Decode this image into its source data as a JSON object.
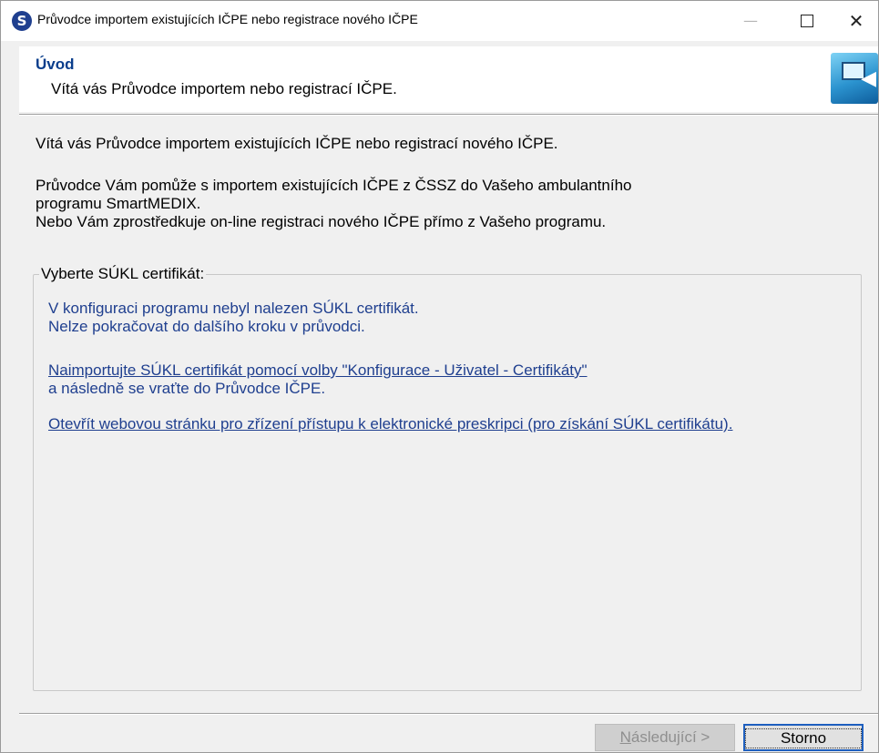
{
  "window": {
    "title": "Průvodce importem existujících IČPE nebo registrace nového IČPE",
    "app_icon_letter": "S",
    "controls": {
      "minimize": "—",
      "maximize": "",
      "close": "✕"
    }
  },
  "header": {
    "title": "Úvod",
    "subtitle": "Vítá vás Průvodce importem nebo registrací IČPE."
  },
  "body": {
    "welcome": "Vítá vás Průvodce importem existujících IČPE nebo registrací nového IČPE.",
    "description": [
      "Průvodce Vám pomůže s importem existujících IČPE z ČSSZ do Vašeho ambulantního",
      "programu SmartMEDIX.",
      "Nebo Vám zprostředkuje on-line registraci nového IČPE přímo z Vašeho programu."
    ]
  },
  "certificate_group": {
    "label": "Vyberte SÚKL certifikát:",
    "not_found_line1": "V konfiguraci programu nebyl nalezen SÚKL certifikát.",
    "not_found_line2": "Nelze pokračovat do dalšího kroku v průvodci.",
    "import_link": "Naimportujte SÚKL certifikát pomocí volby \"Konfigurace - Uživatel - Certifikáty\"",
    "import_after": "a následně se vraťte do Průvodce IČPE.",
    "web_link": "Otevřít webovou stránku pro zřízení přístupu k elektronické preskripci (pro získání SÚKL certifikátu)."
  },
  "footer": {
    "next_access_key": "N",
    "next_rest": "ásledující >",
    "cancel_label": "Storno"
  }
}
